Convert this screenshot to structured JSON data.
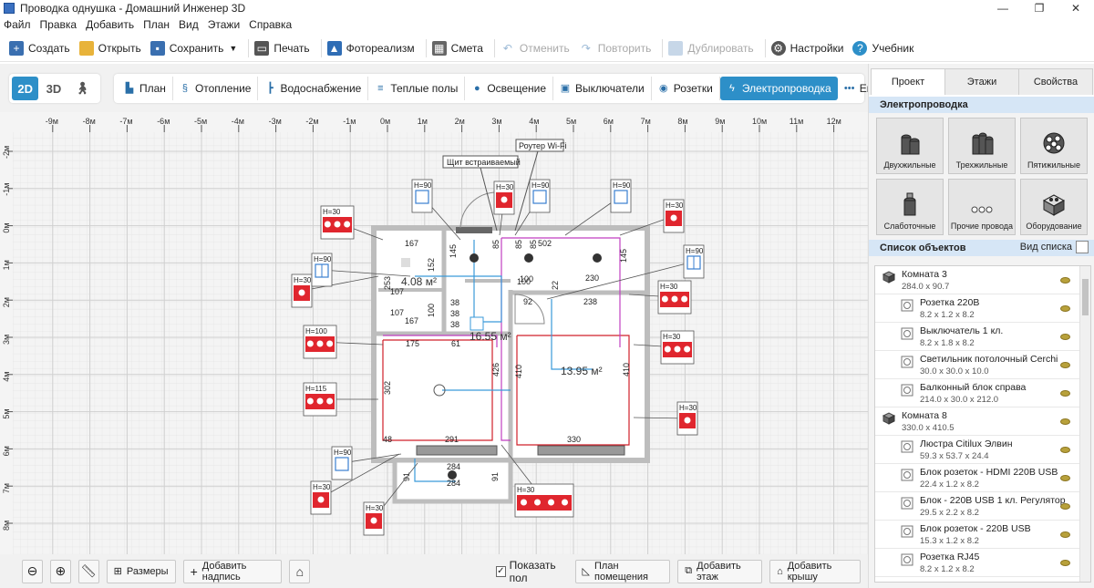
{
  "window": {
    "title": "Проводка однушка - Домашний Инженер 3D",
    "controls": [
      "—",
      "❐",
      "✕"
    ]
  },
  "menu": [
    "Файл",
    "Правка",
    "Добавить",
    "План",
    "Вид",
    "Этажи",
    "Справка"
  ],
  "toolbar": {
    "create": "Создать",
    "open": "Открыть",
    "save": "Сохранить",
    "print": "Печать",
    "photo": "Фотореализм",
    "estimate": "Смета",
    "undo": "Отменить",
    "redo": "Повторить",
    "duplicate": "Дублировать",
    "settings": "Настройки",
    "tutorial": "Учебник"
  },
  "view_modes": {
    "mode2d": "2D",
    "mode3d": "3D"
  },
  "mode_tabs": [
    "План",
    "Отопление",
    "Водоснабжение",
    "Теплые полы",
    "Освещение",
    "Выключатели",
    "Розетки",
    "Электропроводка",
    "Еще"
  ],
  "active_mode": "Электропроводка",
  "ruler": {
    "x_labels": [
      "-9м",
      "-8м",
      "-7м",
      "-6м",
      "-5м",
      "-4м",
      "-3м",
      "-2м",
      "-1м",
      "0м",
      "1м",
      "2м",
      "3м",
      "4м",
      "5м",
      "6м",
      "7м",
      "8м",
      "9м",
      "10м",
      "11м",
      "12м"
    ],
    "y_labels": [
      "-2м",
      "-1м",
      "0м",
      "1м",
      "2м",
      "3м",
      "4м",
      "5м",
      "6м",
      "7м",
      "8м"
    ]
  },
  "plan": {
    "labels": {
      "router": "Роутер Wi-Fi",
      "panel": "Щит встраиваемый",
      "area_small": "4.08 м²",
      "area_main": "16.55 м²",
      "area_right": "13.95 м²"
    },
    "dims": [
      "167",
      "152",
      "145",
      "85",
      "85",
      "85",
      "502",
      "230",
      "145",
      "253",
      "107",
      "107",
      "167",
      "100",
      "38",
      "38",
      "38",
      "100",
      "92",
      "22",
      "238",
      "175",
      "61",
      "426",
      "410",
      "302",
      "410",
      "291",
      "48",
      "330",
      "284",
      "284",
      "91",
      "91",
      "100"
    ],
    "tags": [
      "H=90",
      "H=30",
      "H=90",
      "H=90",
      "H=30",
      "H=30",
      "H=90",
      "H=30",
      "H=30",
      "H=90",
      "H=100",
      "H=30",
      "H=115",
      "H=30",
      "H=90",
      "H=30",
      "H=30",
      "H=30"
    ]
  },
  "bottom": {
    "dimensions": "Размеры",
    "add_label": "Добавить надпись",
    "show_floor": "Показать пол",
    "room_plan": "План помещения",
    "add_floor": "Добавить этаж",
    "add_roof": "Добавить крышу"
  },
  "right_panel": {
    "tabs": [
      "Проект",
      "Этажи",
      "Свойства"
    ],
    "active_tab": "Проект",
    "wiring_header": "Электропроводка",
    "wiring_types": [
      "Двухжильные",
      "Трехжильные",
      "Пятижильные",
      "Слаботочные",
      "Прочие провода",
      "Оборудование"
    ],
    "objects_header": "Список объектов",
    "view_list": "Вид списка",
    "objects": [
      {
        "kind": "room",
        "name": "Комната 3",
        "dims": "284.0 x 90.7"
      },
      {
        "kind": "item",
        "name": "Розетка 220В",
        "dims": "8.2 x 1.2 x 8.2"
      },
      {
        "kind": "item",
        "name": "Выключатель 1 кл.",
        "dims": "8.2 x 1.8 x 8.2"
      },
      {
        "kind": "item",
        "name": "Светильник потолочный Cerchi",
        "dims": "30.0 x 30.0 x 10.0"
      },
      {
        "kind": "item",
        "name": "Балконный блок справа",
        "dims": "214.0 x 30.0 x 212.0"
      },
      {
        "kind": "room",
        "name": "Комната 8",
        "dims": "330.0 x 410.5"
      },
      {
        "kind": "item",
        "name": "Люстра Citilux Элвин",
        "dims": "59.3 x 53.7 x 24.4"
      },
      {
        "kind": "item",
        "name": "Блок розеток - HDMI 220В USB",
        "dims": "22.4 x 1.2 x 8.2"
      },
      {
        "kind": "item",
        "name": "Блок - 220В USB 1 кл. Регулятор",
        "dims": "29.5 x 2.2 x 8.2"
      },
      {
        "kind": "item",
        "name": "Блок розеток - 220В USB",
        "dims": "15.3 x 1.2 x 8.2"
      },
      {
        "kind": "item",
        "name": "Розетка RJ45",
        "dims": "8.2 x 1.2 x 8.2"
      }
    ]
  },
  "colors": {
    "accent": "#2d8fc8",
    "wire_red": "#d0202a",
    "wire_blue": "#3a9ad9",
    "wire_magenta": "#c03fc0",
    "socket_red": "#e0262e"
  }
}
